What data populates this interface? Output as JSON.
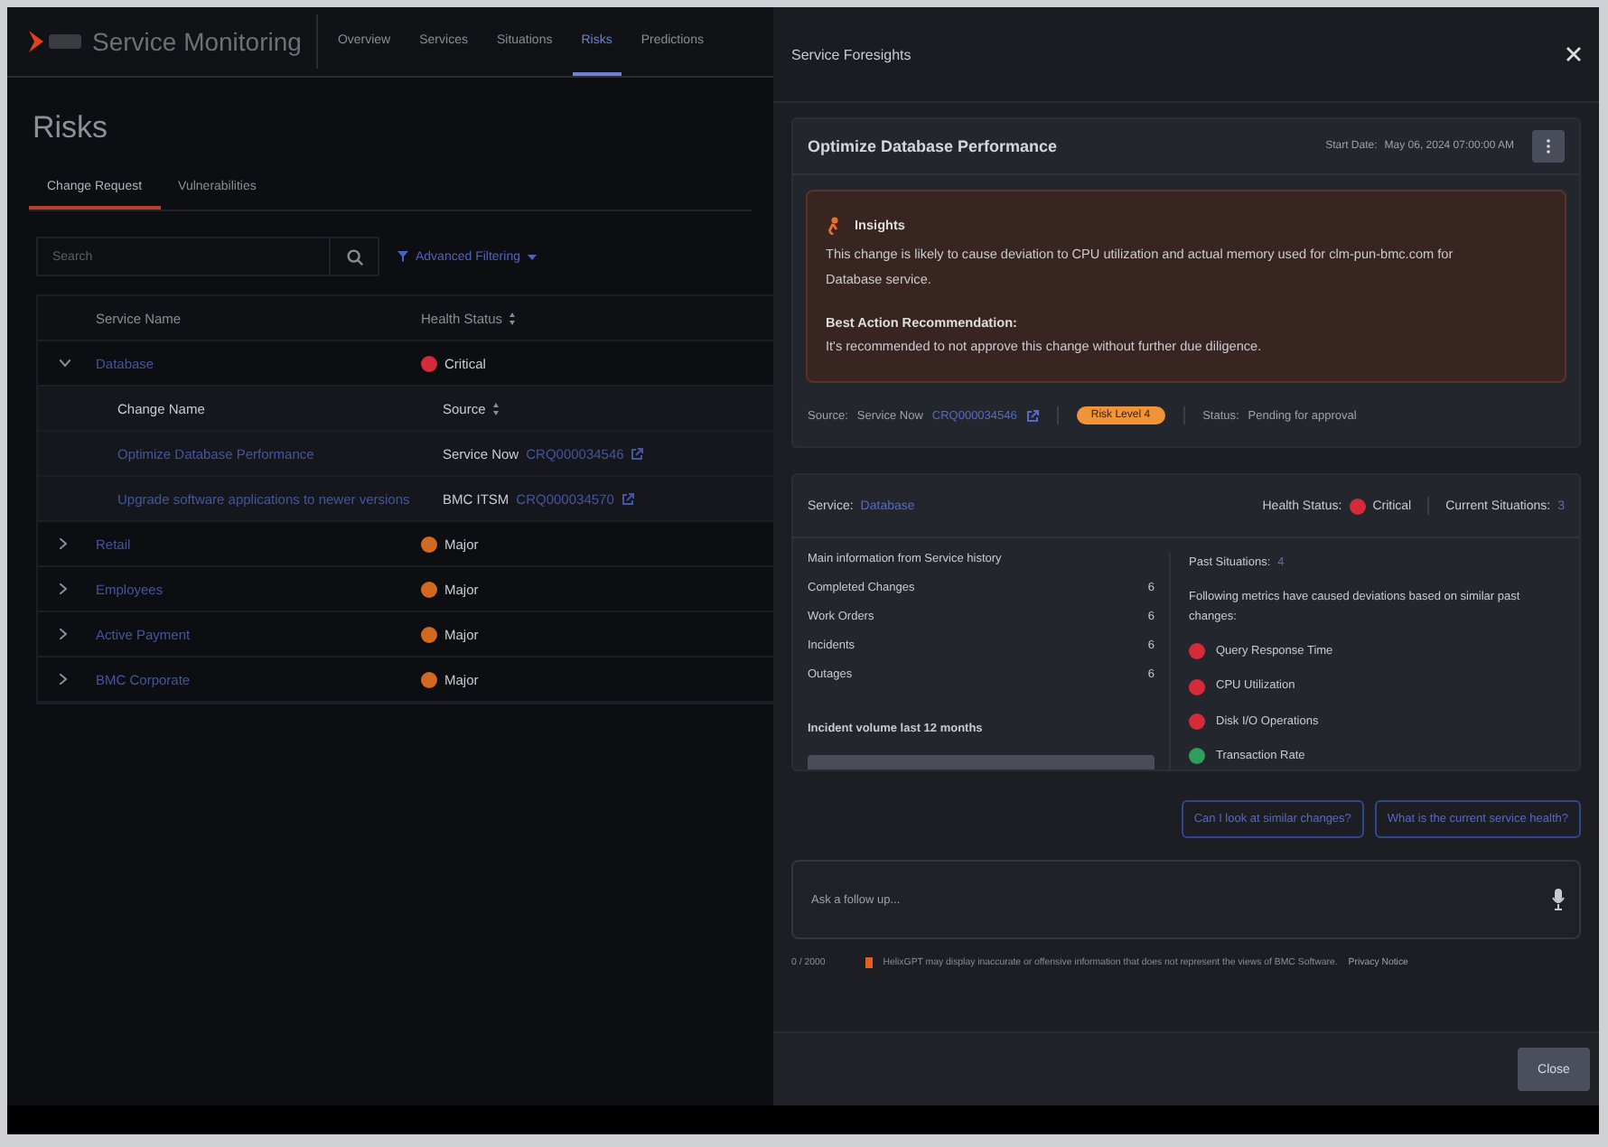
{
  "app": {
    "product": "Service Monitoring",
    "nav": [
      {
        "label": "Overview",
        "selected": false
      },
      {
        "label": "Services",
        "selected": false
      },
      {
        "label": "Situations",
        "selected": false
      },
      {
        "label": "Risks",
        "selected": true
      },
      {
        "label": "Predictions",
        "selected": false
      }
    ]
  },
  "page_title": "Risks",
  "tabs": [
    {
      "label": "Change Request",
      "selected": true
    },
    {
      "label": "Vulnerabilities",
      "selected": false
    }
  ],
  "search": {
    "placeholder": "Search"
  },
  "filter": "Advanced Filtering",
  "table": {
    "columns": [
      "Service Name",
      "Health Status"
    ],
    "rows": [
      {
        "service": "Database",
        "status": "Critical",
        "color": "#d42a3a",
        "expanded": true,
        "child_columns": [
          "Change Name",
          "Source"
        ],
        "changes": [
          {
            "name": "Optimize Database Performance",
            "source": "Service Now",
            "ticket": "CRQ000034546"
          },
          {
            "name": "Upgrade software applications to newer versions",
            "source": "BMC ITSM",
            "ticket": "CRQ000034570"
          }
        ]
      },
      {
        "service": "Retail",
        "status": "Major",
        "color": "#d2691e",
        "expanded": false
      },
      {
        "service": "Employees",
        "status": "Major",
        "color": "#d2691e",
        "expanded": false
      },
      {
        "service": "Active Payment",
        "status": "Major",
        "color": "#d2691e",
        "expanded": false
      },
      {
        "service": "BMC Corporate",
        "status": "Major",
        "color": "#d2691e",
        "expanded": false
      }
    ]
  },
  "panel": {
    "title": "Service Foresights",
    "change": {
      "title": "Optimize Database Performance",
      "start_label": "Start Date:",
      "start_date": "May 06, 2024 07:00:00 AM",
      "insights_title": "Insights",
      "insights_text": "This change is likely to cause deviation to CPU utilization and actual memory used for clm-pun-bmc.com for Database service.",
      "recommendation_title": "Best Action Recommendation:",
      "recommendation_text": "It's recommended to not approve this change without further due diligence.",
      "source_label": "Source:",
      "source": "Service Now",
      "ticket": "CRQ000034546",
      "risk": "Risk Level 4",
      "status_label": "Status:",
      "status": "Pending for approval"
    },
    "service": {
      "label": "Service:",
      "name": "Database",
      "health_label": "Health Status:",
      "health": "Critical",
      "color": "#d42a3a",
      "situations_label": "Current Situations:",
      "situations": "3",
      "history_title": "Main information from Service history",
      "history": [
        {
          "label": "Completed Changes",
          "value": "6"
        },
        {
          "label": "Work Orders",
          "value": "6"
        },
        {
          "label": "Incidents",
          "value": "6"
        },
        {
          "label": "Outages",
          "value": "6"
        }
      ],
      "volume_title": "Incident volume last 12 months",
      "past_label": "Past Situations:",
      "past_count": "4",
      "past_text": "Following metrics have caused deviations based on similar past changes:",
      "metrics": [
        {
          "label": "Query Response Time",
          "color": "#d42a3a"
        },
        {
          "label": "CPU Utilization",
          "color": "#d42a3a"
        },
        {
          "label": "Disk I/O Operations",
          "color": "#d42a3a"
        },
        {
          "label": "Transaction Rate",
          "color": "#2e9e5b"
        }
      ]
    },
    "suggestions": [
      "Can I look at similar changes?",
      "What is the current service health?"
    ],
    "input": {
      "placeholder": "Ask a follow up..."
    },
    "counter": "0 / 2000",
    "disclaimer": "HelixGPT may display inaccurate or offensive information that does not represent the views of BMC Software.",
    "privacy_link": "Privacy Notice",
    "close_button": "Close"
  }
}
